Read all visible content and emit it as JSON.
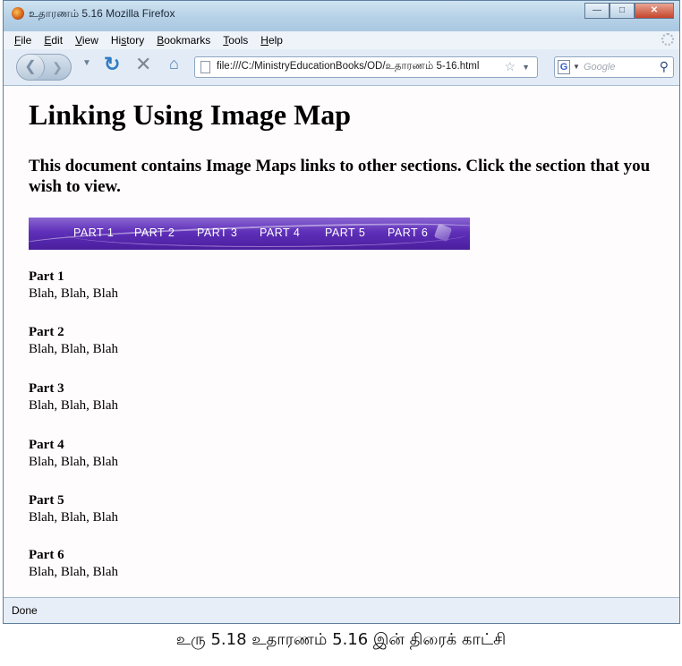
{
  "window": {
    "title": "உதாரணம் 5.16 Mozilla Firefox"
  },
  "menu": [
    "File",
    "Edit",
    "View",
    "History",
    "Bookmarks",
    "Tools",
    "Help"
  ],
  "menu_accel": [
    "F",
    "E",
    "V",
    "s",
    "B",
    "T",
    "H"
  ],
  "address": {
    "url": "file:///C:/MinistryEducationBooks/OD/உதாரணம் 5-16.html"
  },
  "search": {
    "engine": "G",
    "placeholder": "Google"
  },
  "page": {
    "title": "Linking Using Image Map",
    "intro": "This document contains Image Maps links to other sections. Click the section that you wish to view.",
    "map_links": [
      "PART 1",
      "PART 2",
      "PART 3",
      "PART 4",
      "PART 5",
      "PART 6"
    ],
    "sections": [
      {
        "heading": "Part 1",
        "body": "Blah, Blah, Blah"
      },
      {
        "heading": "Part 2",
        "body": "Blah, Blah, Blah"
      },
      {
        "heading": "Part 3",
        "body": "Blah, Blah, Blah"
      },
      {
        "heading": "Part 4",
        "body": "Blah, Blah, Blah"
      },
      {
        "heading": "Part 5",
        "body": "Blah, Blah, Blah"
      },
      {
        "heading": "Part 6",
        "body": "Blah, Blah, Blah"
      }
    ]
  },
  "status": "Done",
  "caption": "உரு 5.18 உதாரணம் 5.16 இன் திரைக் காட்சி",
  "colors": {
    "title_bar": "#b6d1e7",
    "image_map": "#5e2fb8",
    "status_bar": "#e7eef7"
  }
}
